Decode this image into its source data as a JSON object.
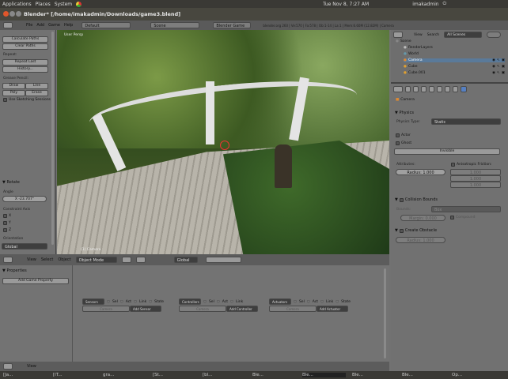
{
  "system_bar": {
    "menus": [
      "Applications",
      "Places",
      "System"
    ],
    "clock": "Tue Nov 8,  7:27 AM",
    "user": "imakadmin"
  },
  "window": {
    "title": "Blender* [/home/imakadmin/Downloads/game3.blend]"
  },
  "blender_header": {
    "menus": [
      "File",
      "Add",
      "Game",
      "Help"
    ],
    "screen": "Default",
    "scene": "Scene",
    "engine": "Blender Game",
    "stats": "blender.org 260 | Ve:570 | Fa:578 | Ob:1-14 | La:1 | Mem:6.60M (12.82M) | Camera"
  },
  "toolshelf": {
    "buttons": [
      "Calculate Paths",
      "Clear Paths"
    ],
    "repeat_label": "Repeat:",
    "repeat_buttons": [
      "Repeat Last",
      "History..."
    ],
    "grease_label": "Grease Pencil:",
    "grease_buttons": [
      "Draw",
      "Line",
      "Poly",
      "Erase"
    ],
    "sketch_session": "Use Sketching Sessions",
    "operator": {
      "title": "Rotate",
      "angle_label": "Angle",
      "angle_value": "X -23.707°",
      "constraint_label": "Constraint Axis",
      "axes": [
        "X",
        "Y",
        "Z"
      ],
      "orientation_label": "Orientation",
      "orientation_value": "Global"
    }
  },
  "viewport": {
    "label": "User Persp",
    "object_label": "(1) Camera"
  },
  "view3d_header": {
    "menus": [
      "View",
      "Select",
      "Object"
    ],
    "mode": "Object Mode",
    "orientation": "Global"
  },
  "logic": {
    "properties_title": "Properties",
    "add_property": "Add Game Property",
    "columns": [
      {
        "type": "Sensors",
        "options": [
          "Sel",
          "Act",
          "Link",
          "State"
        ],
        "object": "Camera",
        "add": "Add Sensor"
      },
      {
        "type": "Controllers",
        "options": [
          "Sel",
          "Act",
          "Link"
        ],
        "object": "Camera",
        "add": "Add Controller"
      },
      {
        "type": "Actuators",
        "options": [
          "Sel",
          "Act",
          "Link",
          "State"
        ],
        "object": "Camera",
        "add": "Add Actuator"
      }
    ]
  },
  "logic_header": {
    "menus": [
      "View"
    ]
  },
  "outliner": {
    "menus": [
      "View",
      "Search"
    ],
    "filter": "All Scenes",
    "items": [
      "Scene",
      "RenderLayers",
      "World",
      "Camera",
      "Cube",
      "Cube.001"
    ]
  },
  "properties": {
    "context": "Camera",
    "physics": {
      "title": "Physics",
      "type_label": "Physics Type:",
      "type_value": "Static",
      "actor": "Actor",
      "ghost": "Ghost",
      "invisible": "Invisible",
      "attributes_label": "Attributes:",
      "radius": "Radius: 1.000",
      "aniso_label": "Anisotropic Friction:",
      "aniso_values": [
        "1.000",
        "1.000",
        "1.000"
      ]
    },
    "collision": {
      "title": "Collision Bounds",
      "bounds_label": "Bounds:",
      "bounds_value": "Box",
      "margin": "Margin: 0.000",
      "compound": "Compound"
    },
    "obstacle": {
      "title": "Create Obstacle",
      "radius": "Radius: 1.000"
    }
  },
  "taskbar": {
    "items": [
      "[Ja...",
      "[iT...",
      "gra...",
      "[St...",
      "[bl...",
      "Ble...",
      "Ble...",
      "Ble...",
      "Ble...",
      "Op..."
    ]
  }
}
